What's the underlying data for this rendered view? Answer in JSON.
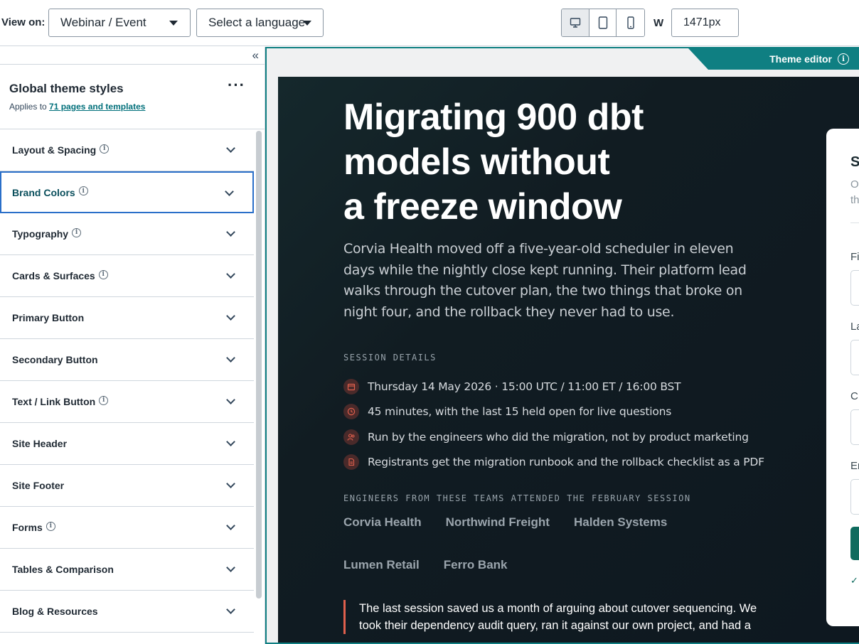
{
  "toolbar": {
    "view_on_label": "View on:",
    "view_on_value": "Webinar / Event",
    "language_value": "Select a language",
    "devices": [
      "desktop-icon",
      "tablet-icon",
      "mobile-icon"
    ],
    "width_label": "W",
    "width_value": "1471px"
  },
  "panel": {
    "collapse_glyph": "«",
    "title": "Global theme styles",
    "applies_prefix": "Applies to",
    "applies_link": "71 pages and templates",
    "more_glyph": "···",
    "sections": [
      {
        "label": "Layout & Spacing",
        "info": true
      },
      {
        "label": "Brand Colors",
        "info": true
      },
      {
        "label": "Typography",
        "info": true
      },
      {
        "label": "Cards & Surfaces",
        "info": true
      },
      {
        "label": "Primary Button",
        "info": false
      },
      {
        "label": "Secondary Button",
        "info": false
      },
      {
        "label": "Text / Link Button",
        "info": true
      },
      {
        "label": "Site Header",
        "info": false
      },
      {
        "label": "Site Footer",
        "info": false
      },
      {
        "label": "Forms",
        "info": true
      },
      {
        "label": "Tables & Comparison",
        "info": false
      },
      {
        "label": "Blog & Resources",
        "info": false
      }
    ],
    "active_section": "Brand Colors"
  },
  "preview": {
    "theme_editor_label": "Theme editor",
    "hero": {
      "title_line1": "Migrating 900 dbt",
      "title_line2": "models without",
      "title_line3": "a freeze window",
      "subtitle": "Corvia Health moved off a five-year-old scheduler in eleven days while the nightly close kept running. Their platform lead walks through the cutover plan, the two things that broke on night four, and the rollback they never had to use."
    },
    "session_label": "SESSION DETAILS",
    "details": [
      {
        "icon": "calendar-icon",
        "text": "Thursday 14 May 2026 · 15:00 UTC / 11:00 ET / 16:00 BST"
      },
      {
        "icon": "clock-icon",
        "text": "45 minutes, with the last 15 held open for live questions"
      },
      {
        "icon": "people-icon",
        "text": "Run by the engineers who did the migration, not by product marketing"
      },
      {
        "icon": "document-icon",
        "text": "Registrants get the migration runbook and the rollback checklist as a PDF"
      }
    ],
    "teams_label": "ENGINEERS FROM THESE TEAMS ATTENDED THE FEBRUARY SESSION",
    "teams": [
      "Corvia Health",
      "Northwind Freight",
      "Halden Systems",
      "Lumen Retail",
      "Ferro Bank"
    ],
    "quote": "The last session saved us a month of arguing about cutover sequencing. We took their dependency audit query, ran it against our own project, and had a",
    "form_card": {
      "heading_initial": "S",
      "line1": "O",
      "line2": "th",
      "labels": [
        "Fi",
        "La",
        "C",
        "Er"
      ],
      "check": "✓"
    }
  },
  "colors": {
    "accent_teal": "#0f7f82",
    "active_border": "#2a6fc9",
    "hero_bg": "#111c22",
    "icon_red": "#e0604d"
  }
}
